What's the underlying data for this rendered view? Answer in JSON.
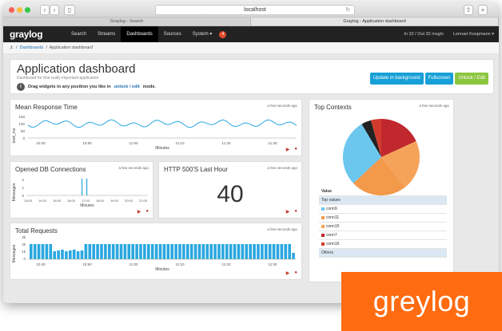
{
  "browser": {
    "address": "localhost",
    "tabs": [
      "Graylog - Search",
      "Graylog - Application dashboard"
    ]
  },
  "nav": {
    "logo": "graylog",
    "items": [
      "Search",
      "Streams",
      "Dashboards",
      "Sources",
      "System ▾"
    ],
    "active": "Dashboards",
    "notification_count": "4",
    "throughput": "In 32 / Out 32 msg/s",
    "user": "Lennart Koopmann ▾"
  },
  "breadcrumb": {
    "home": "⚓",
    "sep": "/",
    "dashboards": "Dashboards",
    "current": "Application dashboard"
  },
  "header": {
    "title": "Application dashboard",
    "subtitle": "Dashboard for that really important application",
    "hint_pre": "Drag widgets to any position you like in",
    "hint_link": "unlock / edit",
    "hint_post": "mode.",
    "buttons": {
      "background": "Update in background",
      "fullscreen": "Fullscreen",
      "unlock": "Unlock / Edit"
    }
  },
  "widgets": {
    "mean_response": {
      "title": "Mean Response Time",
      "time": "a few seconds ago",
      "ylabel": "took_ms",
      "xlabel": "Minutes",
      "yticks": [
        "150",
        "100",
        "50",
        "0"
      ],
      "xticks": [
        "10:40",
        "10:50",
        "11:00",
        "11:10",
        "11:20",
        "11:30"
      ]
    },
    "db_connections": {
      "title": "Opened DB Connections",
      "time": "a few seconds ago",
      "ylabel": "Messages",
      "xlabel": "Minutes",
      "yticks": [
        "2",
        "1",
        "0"
      ],
      "xticks": [
        "13:00",
        "14:00",
        "15:00",
        "16:00",
        "17:00",
        "18:00",
        "19:00",
        "20:00",
        "21:00"
      ]
    },
    "http500": {
      "title": "HTTP 500'S Last Hour",
      "time": "a few seconds ago",
      "value": "40"
    },
    "total_requests": {
      "title": "Total Requests",
      "time": "a few seconds ago",
      "ylabel": "Messages",
      "xlabel": "Minutes",
      "yticks": [
        "3k",
        "2k",
        "1k",
        "0"
      ],
      "xticks": [
        "10:40",
        "10:50",
        "11:00",
        "11:10",
        "11:20",
        "11:30"
      ]
    },
    "top_contexts": {
      "title": "Top Contexts",
      "time": "a few seconds ago",
      "table_head": "Value",
      "table_sub": "Top values",
      "rows": [
        {
          "label": "conn9",
          "color": "#6cc7ee"
        },
        {
          "label": "conn11",
          "color": "#f2994a"
        },
        {
          "label": "conn15",
          "color": "#f6a35a"
        },
        {
          "label": "conn7",
          "color": "#c0282e"
        },
        {
          "label": "conn16",
          "color": "#d13b2e"
        }
      ],
      "others": "Others"
    }
  },
  "brand_label": "greylog",
  "colors": {
    "accent": "#16a0d7",
    "green": "#8dc63f",
    "line": "#2aa7e0",
    "brand": "#ff6b10"
  }
}
